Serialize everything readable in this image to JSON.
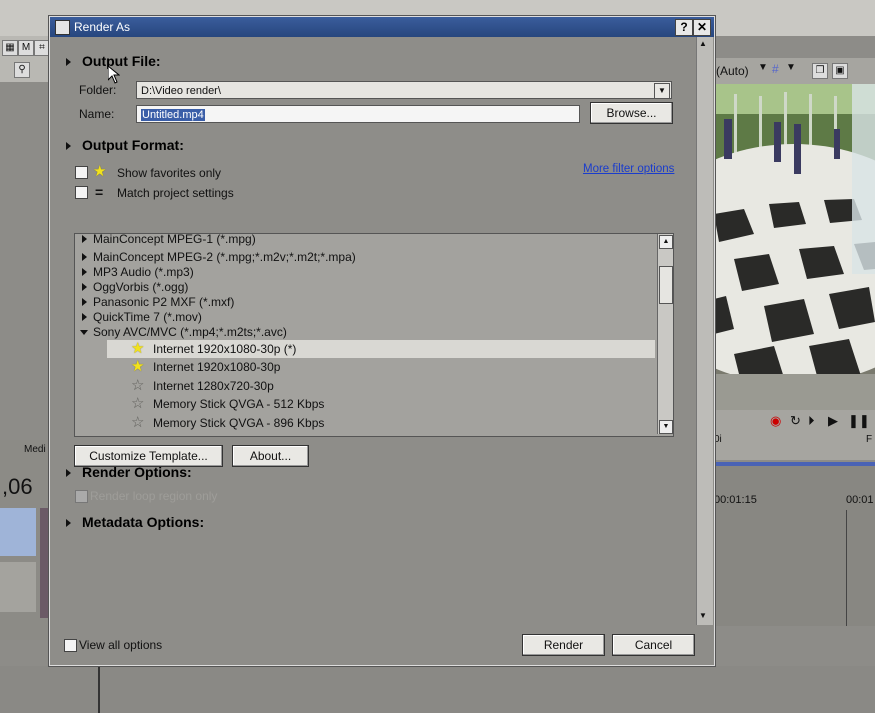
{
  "background": {
    "timecode": ",06",
    "toolbar_auto": "(Auto)",
    "timeline_mark_1": "00:01:15",
    "timeline_mark_2": "00:01",
    "media_tab": "Medi"
  },
  "dialog": {
    "title": "Render As",
    "help_button": "?",
    "close_button": "✕",
    "output_file": {
      "header": "Output File:",
      "folder_label": "Folder:",
      "folder_value": "D:\\Video render\\",
      "name_label": "Name:",
      "name_value": "Untitled.mp4",
      "browse_label": "Browse..."
    },
    "output_format": {
      "header": "Output Format:",
      "show_favorites": "Show favorites only",
      "match_project": "Match project settings",
      "more_filter": "More filter options",
      "formats": [
        "MainConcept MPEG-1 (*.mpg)",
        "MainConcept MPEG-2 (*.mpg;*.m2v;*.m2t;*.mpa)",
        "MP3 Audio (*.mp3)",
        "OggVorbis (*.ogg)",
        "Panasonic P2 MXF (*.mxf)",
        "QuickTime 7 (*.mov)",
        "Sony AVC/MVC (*.mp4;*.m2ts;*.avc)"
      ],
      "templates": [
        {
          "label": "Internet 1920x1080-30p (*)",
          "favorite": true,
          "selected": true
        },
        {
          "label": "Internet 1920x1080-30p",
          "favorite": true,
          "selected": false
        },
        {
          "label": "Internet 1280x720-30p",
          "favorite": false,
          "selected": false
        },
        {
          "label": "Memory Stick QVGA - 512 Kbps",
          "favorite": false,
          "selected": false
        },
        {
          "label": "Memory Stick QVGA - 896 Kbps",
          "favorite": false,
          "selected": false
        }
      ],
      "customize_label": "Customize Template...",
      "about_label": "About..."
    },
    "render_options": {
      "header": "Render Options:",
      "loop_region": "Render loop region only"
    },
    "metadata_options": {
      "header": "Metadata Options:"
    },
    "view_all": "View all options",
    "render_label": "Render",
    "cancel_label": "Cancel"
  },
  "colors": {
    "title_bar": "#2f5190",
    "link": "#1a3ccc",
    "favorite_star": "#f2e21c"
  }
}
